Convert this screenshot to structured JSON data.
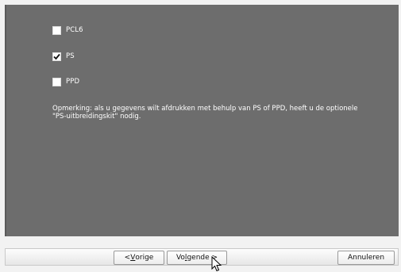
{
  "options": [
    {
      "label": "PCL6",
      "checked": false
    },
    {
      "label": "PS",
      "checked": true
    },
    {
      "label": "PPD",
      "checked": false
    }
  ],
  "note": "Opmerking: als u gegevens wilt afdrukken met behulp van PS of PPD, heeft u de optionele\n\"PS-uitbreidingskit\" nodig.",
  "buttons": {
    "back_prefix": "< ",
    "back_mnemonic": "V",
    "back_rest": "orige",
    "next_prefix": "Vo",
    "next_mnemonic": "l",
    "next_rest": "gende >",
    "cancel": "Annuleren"
  }
}
